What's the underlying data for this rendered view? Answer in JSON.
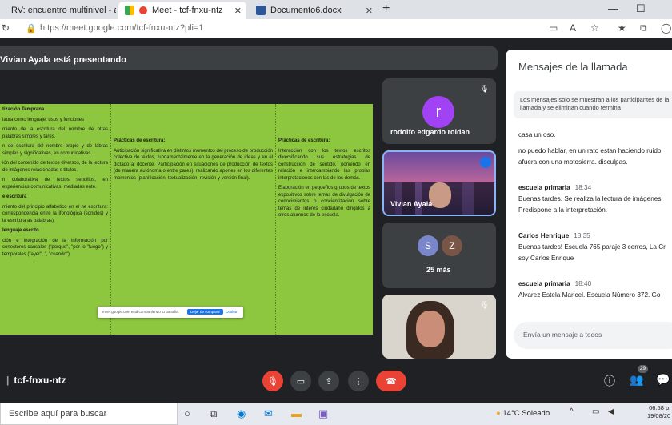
{
  "browser": {
    "tabs": [
      {
        "label": "RV: encuentro multinivel - ayala",
        "active": false
      },
      {
        "label": "Meet - tcf-fnxu-ntz",
        "active": true
      },
      {
        "label": "Documento6.docx",
        "active": false
      }
    ],
    "url_host": "https://meet.google.com/",
    "url_path": "tcf-fnxu-ntz?pli=1"
  },
  "presentation": {
    "title": "Vivian Ayala está presentando",
    "slide": {
      "col1": [
        {
          "bold": true,
          "text": "tización Temprana"
        },
        {
          "bold": false,
          "text": "laura como lenguaje: usos y funciones"
        },
        {
          "bold": false,
          "text": "miento de la escritura del nombre de otras palabras simples y tares."
        },
        {
          "bold": false,
          "text": "n de escritura del nombre propio y de labras simples y significativas, en comunicativas."
        },
        {
          "bold": false,
          "text": "ión del contenido de textos diversos, de la lectura de imágenes relacionadas s títulos."
        },
        {
          "bold": false,
          "text": "n colaborativa de textos sencillos, en experiencias comunicativas, mediadas ente."
        },
        {
          "bold": true,
          "text": "e escritura"
        },
        {
          "bold": false,
          "text": "miento del principio alfabético en el ne escritura: correspondencia entre la ifonológica (sonidos) y la escritura as palabras)."
        },
        {
          "bold": true,
          "text": "lenguaje escrito"
        },
        {
          "bold": false,
          "text": "ción e integración de la información por conectores causales (\"porque\", \"por lo \"luego\") y temporales (\"ayer\", \", \"cuando\")"
        }
      ],
      "col2": [
        {
          "bold": true,
          "text": "Prácticas de escritura:"
        },
        {
          "bold": false,
          "text": "Anticipación significativa en distintos momentos del proceso de producción colectiva de textos, fundamentalmente en la generación de ideas y en el dictado al docente. Participación en situaciones de producción de textos (de manera autónoma o entre pares), realizando aportes en los diferentes momentos (planificación, textualización, revisión y versión final)."
        }
      ],
      "col3": [
        {
          "bold": true,
          "text": "Prácticas de escritura:"
        },
        {
          "bold": false,
          "text": "Interacción con los textos escritos diversificando sus estrategias de construcción de sentido, poniendo en relación e intercambiando las propias interpretaciones con las de los demás."
        },
        {
          "bold": false,
          "text": "Elaboración en pequeños grupos de textos expositivos sobre temas de divulgación de conocimientos o concientización sobre temas de interés ciudadano dirigidos a otros alumnos de la escuela."
        }
      ]
    },
    "share_popup": {
      "text": "meet.google.com está compartiendo tu pantalla.",
      "stop_label": "Dejar de compartir",
      "hide_label": "Ocultar"
    }
  },
  "participants": {
    "tile1": {
      "initial": "r",
      "name": "rodolfo edgardo roldan",
      "color": "#a142f4"
    },
    "tile2": {
      "name": "Vivian Ayala"
    },
    "tile3": {
      "initials": [
        "S",
        "Z"
      ],
      "more_label": "25 más",
      "colors": [
        "#7986cb",
        "#795548"
      ]
    }
  },
  "chat": {
    "title": "Mensajes de la llamada",
    "notice": "Los mensajes solo se muestran a los participantes de la llamada y se eliminan cuando termina",
    "messages": [
      {
        "sender": "",
        "time": "",
        "lines": [
          "casa un oso."
        ]
      },
      {
        "sender": "",
        "time": "",
        "lines": [
          "no puedo hablar, en un rato estan haciendo ruido",
          "afuera con una motosierra. disculpas."
        ]
      },
      {
        "sender": "escuela primaria",
        "time": "18:34",
        "lines": [
          "Buenas tardes. Se realiza la lectura de imágenes.",
          "Predispone a la interpretación."
        ]
      },
      {
        "sender": "Carlos Henrique",
        "time": "18:35",
        "lines": [
          "Buenas tardes! Escuela 765 paraje 3 cerros, La Cr",
          "soy Carlos Enrique"
        ]
      },
      {
        "sender": "escuela primaria",
        "time": "18:40",
        "lines": [
          "Alvarez Estela Maricel. Escuela Número 372. Go"
        ]
      }
    ],
    "input_placeholder": "Envía un mensaje a todos"
  },
  "meeting": {
    "code": "tcf-fnxu-ntz",
    "participant_count": "29"
  },
  "taskbar": {
    "search_placeholder": "Escribe aquí para buscar",
    "weather": "14°C  Soleado",
    "time": "06:58 p.",
    "date": "19/08/20"
  }
}
